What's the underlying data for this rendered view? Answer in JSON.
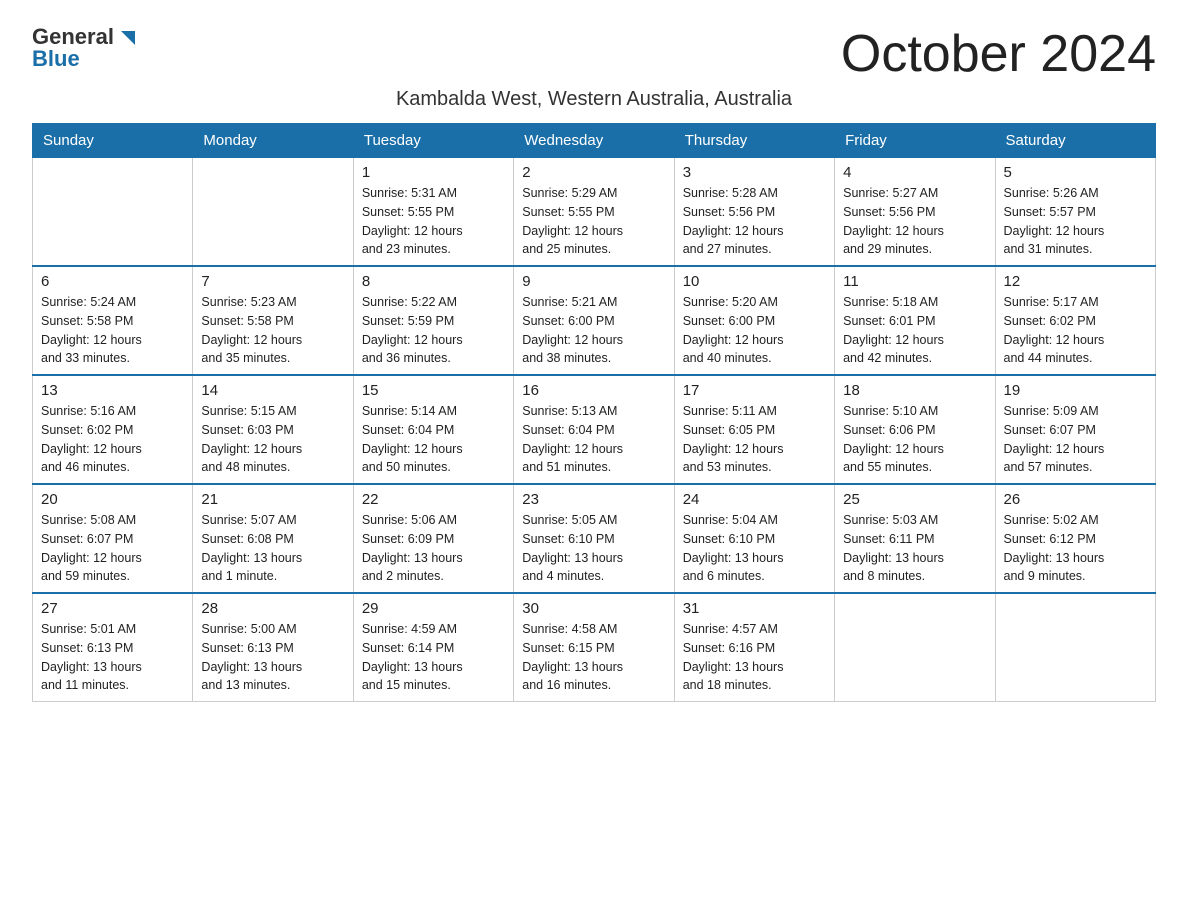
{
  "logo": {
    "general": "General",
    "blue": "Blue"
  },
  "title": "October 2024",
  "subtitle": "Kambalda West, Western Australia, Australia",
  "days_of_week": [
    "Sunday",
    "Monday",
    "Tuesday",
    "Wednesday",
    "Thursday",
    "Friday",
    "Saturday"
  ],
  "weeks": [
    [
      {
        "day": "",
        "detail": ""
      },
      {
        "day": "",
        "detail": ""
      },
      {
        "day": "1",
        "detail": "Sunrise: 5:31 AM\nSunset: 5:55 PM\nDaylight: 12 hours\nand 23 minutes."
      },
      {
        "day": "2",
        "detail": "Sunrise: 5:29 AM\nSunset: 5:55 PM\nDaylight: 12 hours\nand 25 minutes."
      },
      {
        "day": "3",
        "detail": "Sunrise: 5:28 AM\nSunset: 5:56 PM\nDaylight: 12 hours\nand 27 minutes."
      },
      {
        "day": "4",
        "detail": "Sunrise: 5:27 AM\nSunset: 5:56 PM\nDaylight: 12 hours\nand 29 minutes."
      },
      {
        "day": "5",
        "detail": "Sunrise: 5:26 AM\nSunset: 5:57 PM\nDaylight: 12 hours\nand 31 minutes."
      }
    ],
    [
      {
        "day": "6",
        "detail": "Sunrise: 5:24 AM\nSunset: 5:58 PM\nDaylight: 12 hours\nand 33 minutes."
      },
      {
        "day": "7",
        "detail": "Sunrise: 5:23 AM\nSunset: 5:58 PM\nDaylight: 12 hours\nand 35 minutes."
      },
      {
        "day": "8",
        "detail": "Sunrise: 5:22 AM\nSunset: 5:59 PM\nDaylight: 12 hours\nand 36 minutes."
      },
      {
        "day": "9",
        "detail": "Sunrise: 5:21 AM\nSunset: 6:00 PM\nDaylight: 12 hours\nand 38 minutes."
      },
      {
        "day": "10",
        "detail": "Sunrise: 5:20 AM\nSunset: 6:00 PM\nDaylight: 12 hours\nand 40 minutes."
      },
      {
        "day": "11",
        "detail": "Sunrise: 5:18 AM\nSunset: 6:01 PM\nDaylight: 12 hours\nand 42 minutes."
      },
      {
        "day": "12",
        "detail": "Sunrise: 5:17 AM\nSunset: 6:02 PM\nDaylight: 12 hours\nand 44 minutes."
      }
    ],
    [
      {
        "day": "13",
        "detail": "Sunrise: 5:16 AM\nSunset: 6:02 PM\nDaylight: 12 hours\nand 46 minutes."
      },
      {
        "day": "14",
        "detail": "Sunrise: 5:15 AM\nSunset: 6:03 PM\nDaylight: 12 hours\nand 48 minutes."
      },
      {
        "day": "15",
        "detail": "Sunrise: 5:14 AM\nSunset: 6:04 PM\nDaylight: 12 hours\nand 50 minutes."
      },
      {
        "day": "16",
        "detail": "Sunrise: 5:13 AM\nSunset: 6:04 PM\nDaylight: 12 hours\nand 51 minutes."
      },
      {
        "day": "17",
        "detail": "Sunrise: 5:11 AM\nSunset: 6:05 PM\nDaylight: 12 hours\nand 53 minutes."
      },
      {
        "day": "18",
        "detail": "Sunrise: 5:10 AM\nSunset: 6:06 PM\nDaylight: 12 hours\nand 55 minutes."
      },
      {
        "day": "19",
        "detail": "Sunrise: 5:09 AM\nSunset: 6:07 PM\nDaylight: 12 hours\nand 57 minutes."
      }
    ],
    [
      {
        "day": "20",
        "detail": "Sunrise: 5:08 AM\nSunset: 6:07 PM\nDaylight: 12 hours\nand 59 minutes."
      },
      {
        "day": "21",
        "detail": "Sunrise: 5:07 AM\nSunset: 6:08 PM\nDaylight: 13 hours\nand 1 minute."
      },
      {
        "day": "22",
        "detail": "Sunrise: 5:06 AM\nSunset: 6:09 PM\nDaylight: 13 hours\nand 2 minutes."
      },
      {
        "day": "23",
        "detail": "Sunrise: 5:05 AM\nSunset: 6:10 PM\nDaylight: 13 hours\nand 4 minutes."
      },
      {
        "day": "24",
        "detail": "Sunrise: 5:04 AM\nSunset: 6:10 PM\nDaylight: 13 hours\nand 6 minutes."
      },
      {
        "day": "25",
        "detail": "Sunrise: 5:03 AM\nSunset: 6:11 PM\nDaylight: 13 hours\nand 8 minutes."
      },
      {
        "day": "26",
        "detail": "Sunrise: 5:02 AM\nSunset: 6:12 PM\nDaylight: 13 hours\nand 9 minutes."
      }
    ],
    [
      {
        "day": "27",
        "detail": "Sunrise: 5:01 AM\nSunset: 6:13 PM\nDaylight: 13 hours\nand 11 minutes."
      },
      {
        "day": "28",
        "detail": "Sunrise: 5:00 AM\nSunset: 6:13 PM\nDaylight: 13 hours\nand 13 minutes."
      },
      {
        "day": "29",
        "detail": "Sunrise: 4:59 AM\nSunset: 6:14 PM\nDaylight: 13 hours\nand 15 minutes."
      },
      {
        "day": "30",
        "detail": "Sunrise: 4:58 AM\nSunset: 6:15 PM\nDaylight: 13 hours\nand 16 minutes."
      },
      {
        "day": "31",
        "detail": "Sunrise: 4:57 AM\nSunset: 6:16 PM\nDaylight: 13 hours\nand 18 minutes."
      },
      {
        "day": "",
        "detail": ""
      },
      {
        "day": "",
        "detail": ""
      }
    ]
  ]
}
